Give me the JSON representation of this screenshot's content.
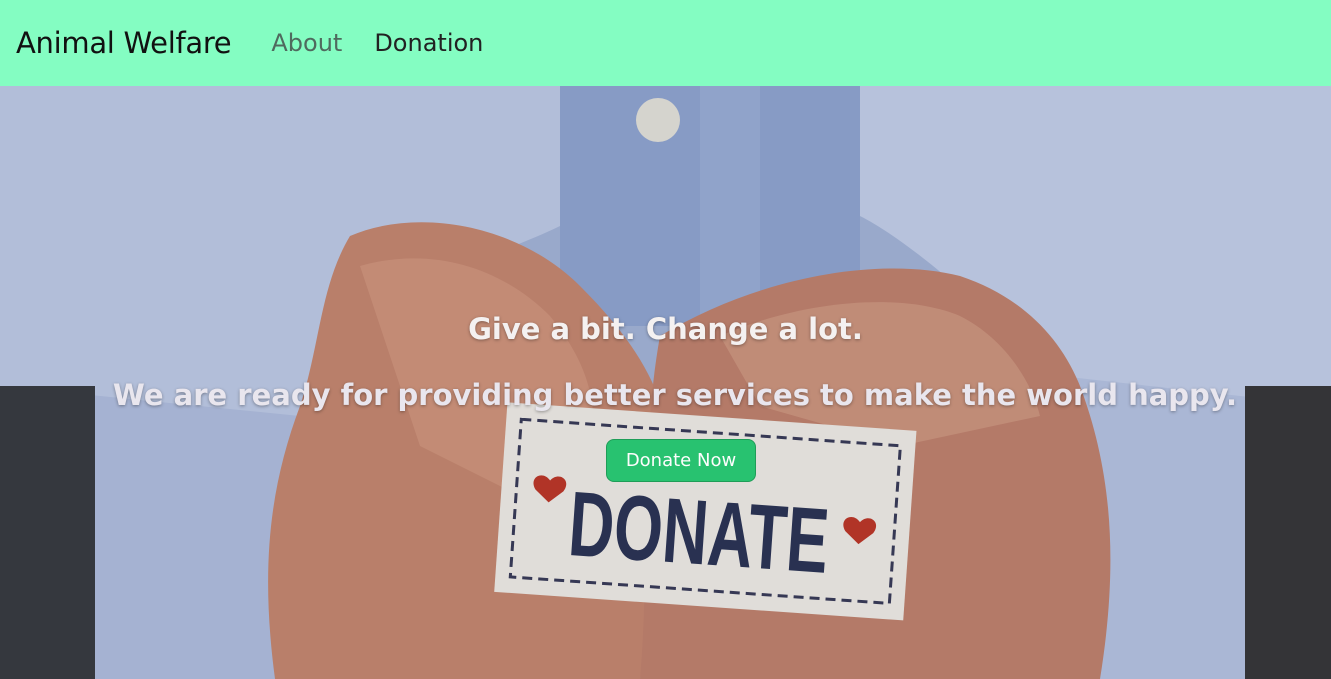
{
  "navbar": {
    "brand": "Animal Welfare",
    "links": [
      {
        "label": "About"
      },
      {
        "label": "Donation"
      }
    ],
    "background": "#84fdc2"
  },
  "hero": {
    "title": "Give a bit. Change a lot.",
    "subtitle": "We are ready for providing better services to make the world happy.",
    "button_label": "Donate Now",
    "card_text": "DONATE",
    "button_color": "#1fc16b"
  }
}
